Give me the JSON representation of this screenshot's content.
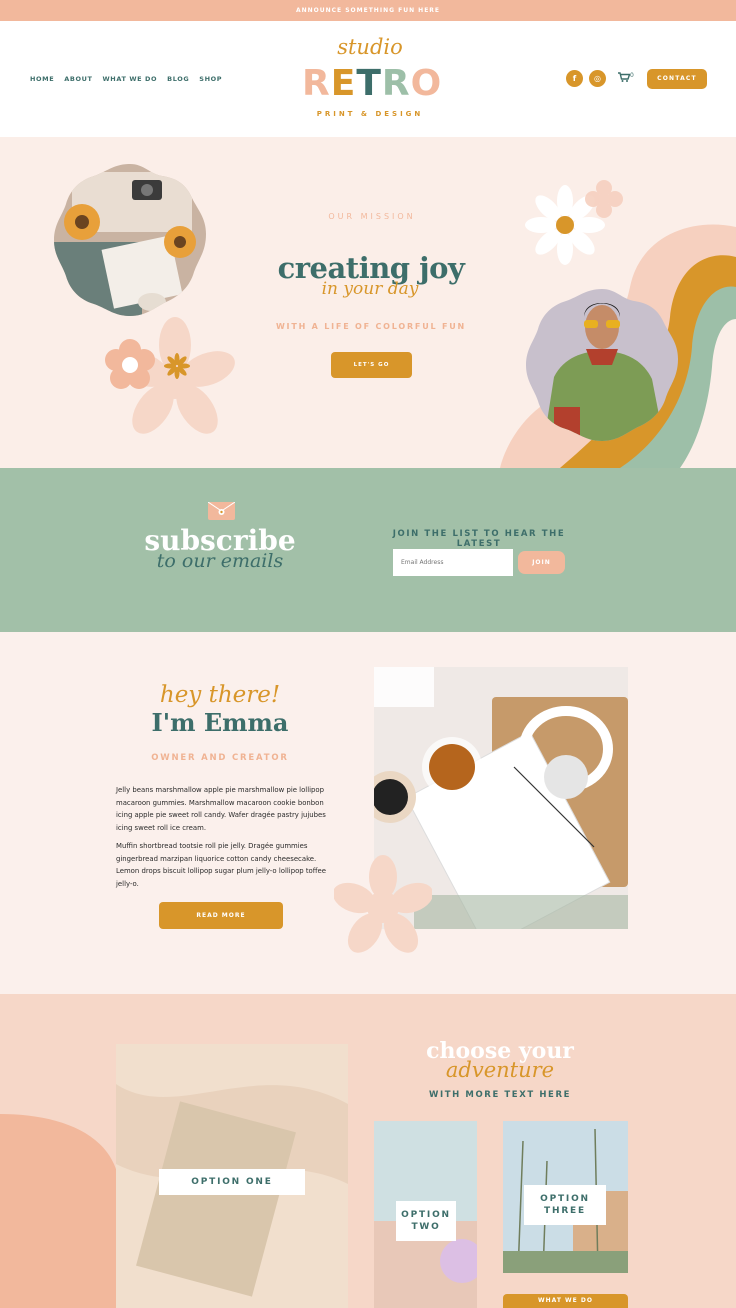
{
  "announce": "ANNOUNCE SOMETHING FUN HERE",
  "nav": [
    "HOME",
    "ABOUT",
    "WHAT WE DO",
    "BLOG",
    "SHOP"
  ],
  "logo": {
    "top": "studio",
    "main": [
      "R",
      "E",
      "T",
      "R",
      "O"
    ],
    "sub": "PRINT & DESIGN"
  },
  "header": {
    "facebook": "f",
    "instagram": "◎",
    "cart_count": "0",
    "contact": "CONTACT"
  },
  "hero": {
    "mission": "OUR MISSION",
    "title": "creating joy",
    "script": "in your day",
    "subtitle": "WITH A LIFE OF COLORFUL FUN",
    "cta": "LET'S GO"
  },
  "subscribe": {
    "title": "subscribe",
    "script": "to our emails",
    "join_label": "JOIN THE LIST TO HEAR THE LATEST",
    "email_placeholder": "Email Address",
    "join_button": "JOIN"
  },
  "about": {
    "hey": "hey there!",
    "name": "I'm Emma",
    "role": "OWNER AND CREATOR",
    "para1": "Jelly beans marshmallow apple pie marshmallow pie lollipop macaroon gummies. Marshmallow macaroon cookie bonbon icing apple pie sweet roll candy. Wafer dragée pastry jujubes icing sweet roll ice cream.",
    "para2": "Muffin shortbread tootsie roll pie jelly. Dragée gummies gingerbread marzipan liquorice cotton candy cheesecake. Lemon drops biscuit lollipop sugar plum jelly-o lollipop toffee jelly-o.",
    "cta": "READ MORE"
  },
  "adventure": {
    "title": "choose your",
    "script": "adventure",
    "subtitle": "WITH MORE TEXT HERE",
    "option_one": "OPTION ONE",
    "option_two": "OPTION TWO",
    "option_three": "OPTION THREE",
    "cta": "WHAT WE DO"
  },
  "colors": {
    "peach": "#f2b89c",
    "mustard": "#d8962a",
    "teal": "#3d6e6a",
    "sage": "#a2c0a8",
    "cream": "#fbf0ec"
  }
}
